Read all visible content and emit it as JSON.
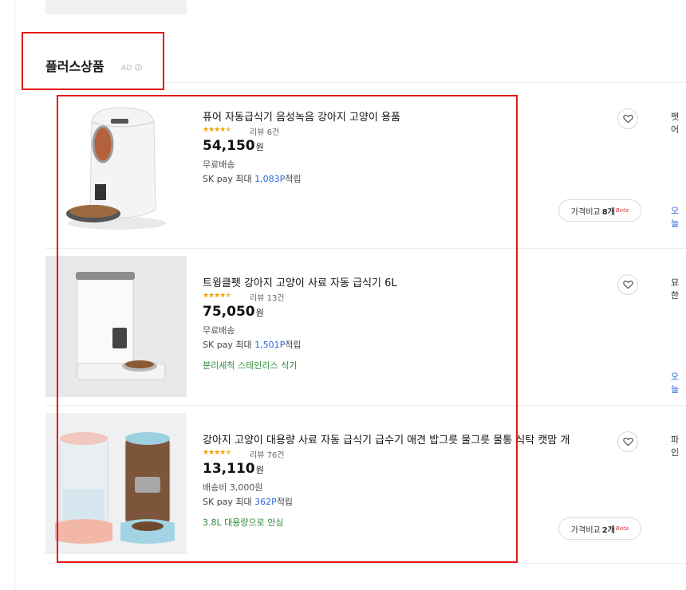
{
  "section": {
    "title": "플러스상품",
    "ad_label": "AD"
  },
  "items": [
    {
      "title": "퓨어 자동급식기 음성녹음 강아지 고양이 용품",
      "stars": "★★★★",
      "review_label": "리뷰 6건",
      "price": "54,150",
      "currency": "원",
      "shipping": "무료배송",
      "pay_prefix": "SK pay 최대 ",
      "pay_points": "1,083P",
      "pay_suffix": "적립",
      "promo": "",
      "compare_label": "가격비교",
      "compare_count": "8개",
      "beta": "Beta",
      "side_text": "펫어",
      "side_link": "오늘"
    },
    {
      "title": "트윙클펫 강아지 고양이 사료 자동 급식기 6L",
      "stars": "★★★★",
      "review_label": "리뷰 13건",
      "price": "75,050",
      "currency": "원",
      "shipping": "무료배송",
      "pay_prefix": "SK pay 최대 ",
      "pay_points": "1,501P",
      "pay_suffix": "적립",
      "promo": "분리세척 스테인리스 식기",
      "compare_label": "",
      "compare_count": "",
      "beta": "",
      "side_text": "묘한",
      "side_link": "오늘"
    },
    {
      "title": "강아지 고양이 대용량 사료 자동 급식기 급수기 애견 밥그릇 물그릇 물통 식탁 캣맘 개",
      "stars": "★★★★",
      "review_label": "리뷰 76건",
      "price": "13,110",
      "currency": "원",
      "shipping": "배송비 3,000원",
      "pay_prefix": "SK pay 최대 ",
      "pay_points": "362P",
      "pay_suffix": "적립",
      "promo": "3.8L 대용량으로 안심",
      "compare_label": "가격비교",
      "compare_count": "2개",
      "beta": "Beta",
      "side_text": "파인",
      "side_link": ""
    }
  ],
  "colors": {
    "highlight": "#e31818",
    "points": "#2a66d6",
    "promo": "#2f8a3e",
    "stars": "#f5a000"
  }
}
